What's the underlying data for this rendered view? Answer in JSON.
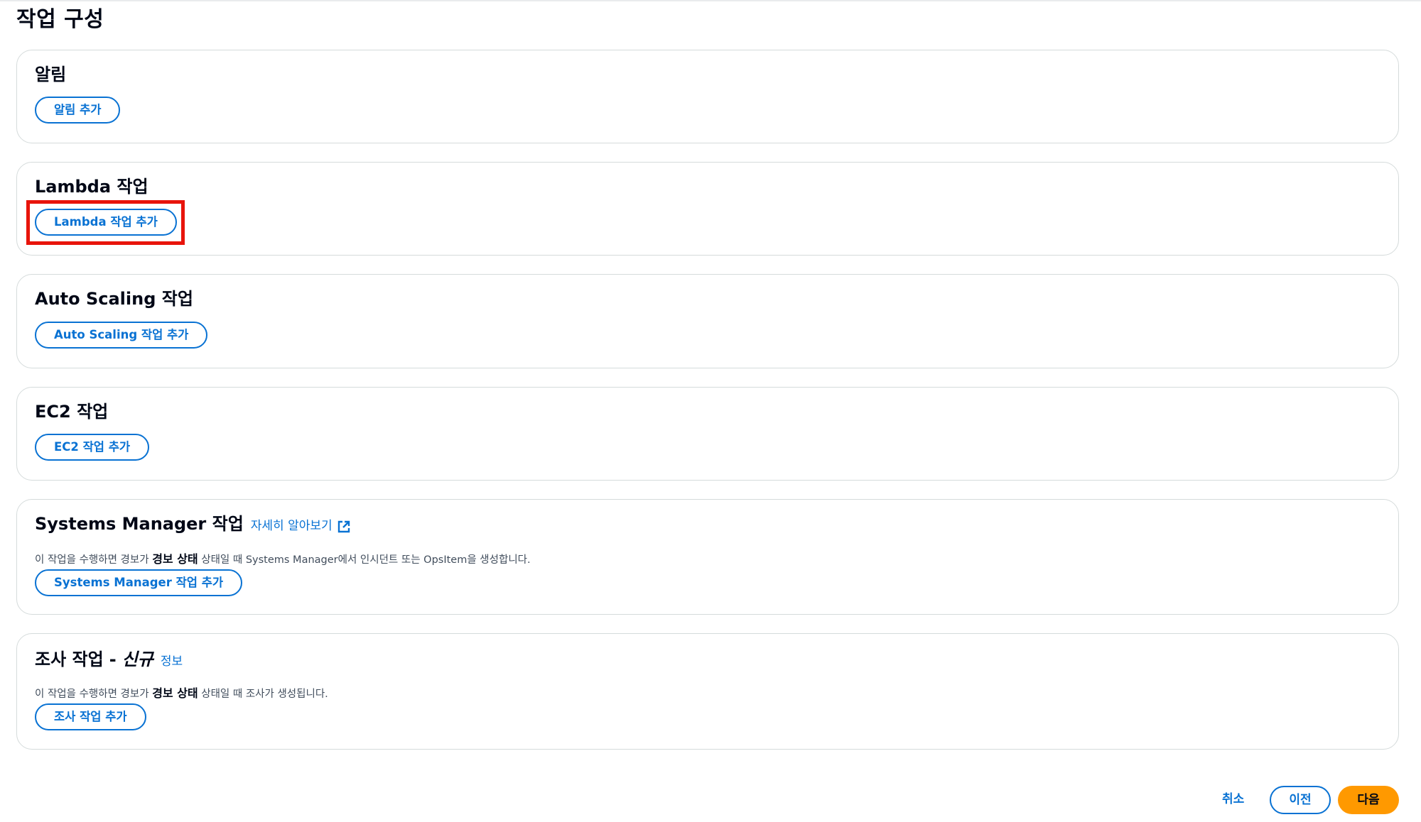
{
  "page": {
    "title": "작업 구성"
  },
  "sections": [
    {
      "title": "알림",
      "button_label": "알림 추가"
    },
    {
      "title": "Lambda 작업",
      "button_label": "Lambda 작업 추가"
    },
    {
      "title": "Auto Scaling 작업",
      "button_label": "Auto Scaling 작업 추가"
    },
    {
      "title": "EC2 작업",
      "button_label": "EC2 작업 추가"
    },
    {
      "title": "Systems Manager 작업",
      "link_label": "자세히 알아보기",
      "description_before": "이 작업을 수행하면 경보가 ",
      "description_bold": "경보 상태",
      "description_after": " 상태일 때 Systems Manager에서 인시던트 또는 OpsItem을 생성합니다.",
      "button_label": "Systems Manager 작업 추가"
    },
    {
      "title": "조사 작업",
      "separator": "-",
      "new_label": "신규",
      "link_label": "정보",
      "description_before": "이 작업을 수행하면 경보가 ",
      "description_bold": "경보 상태",
      "description_after": " 상태일 때 조사가 생성됩니다.",
      "button_label": "조사 작업 추가"
    }
  ],
  "footer": {
    "cancel_label": "취소",
    "previous_label": "이전",
    "next_label": "다음"
  },
  "colors": {
    "link": "#0972d3",
    "primary_button": "#ff9900",
    "highlight": "#e8140b",
    "border": "#d5dbdb"
  },
  "icons": {
    "external_link": "external-link-icon"
  }
}
